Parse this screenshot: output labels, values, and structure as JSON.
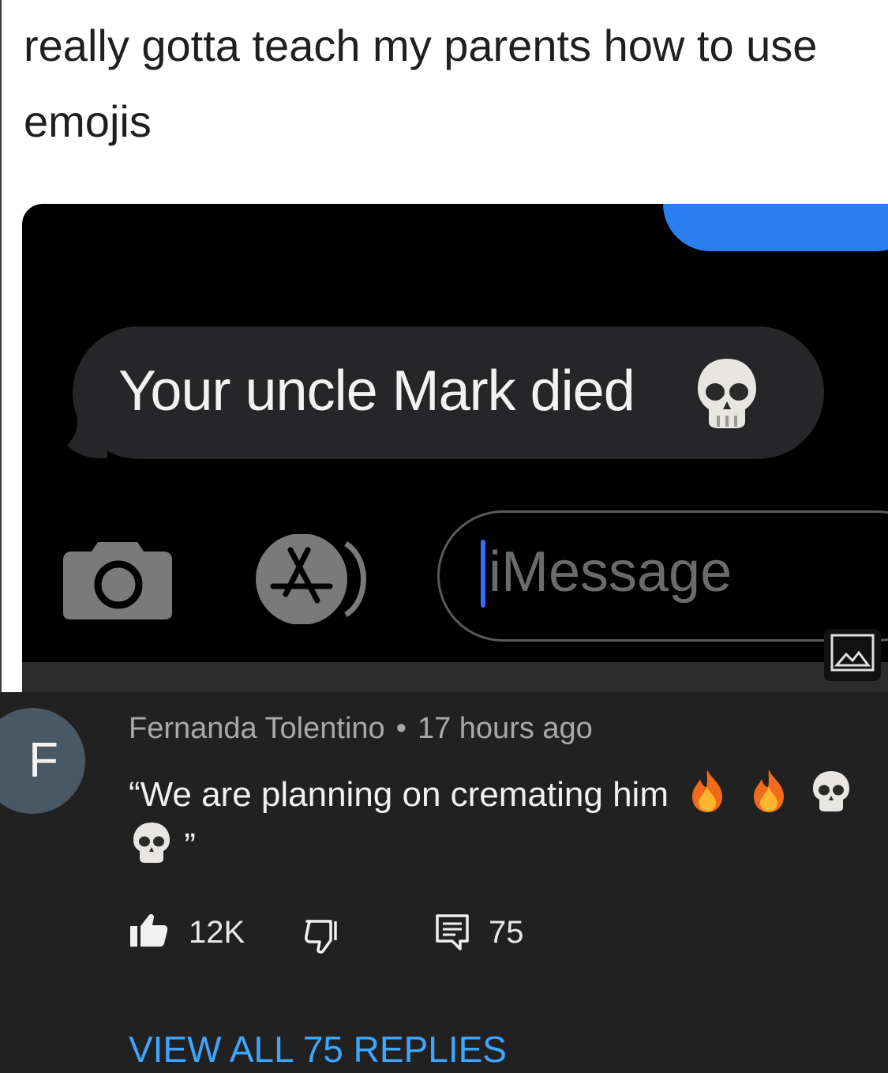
{
  "post": {
    "caption": "really gotta teach my parents how to use emojis"
  },
  "imessage": {
    "incoming_message": "Your uncle Mark died",
    "incoming_emoji": "skull-emoji",
    "input_placeholder": "iMessage",
    "accent_color": "#2a7ef0"
  },
  "comment": {
    "avatar_letter": "F",
    "author": "Fernanda Tolentino",
    "separator": "•",
    "time": "17 hours ago",
    "text": "“We are planning on cremating him",
    "text_end": "”",
    "emojis": [
      "fire-emoji",
      "fire-emoji",
      "skull-emoji",
      "skull-emoji"
    ],
    "like_count": "12K",
    "reply_count": "75",
    "view_replies_label": "VIEW ALL 75 REPLIES",
    "link_color": "#3ea6ff"
  }
}
